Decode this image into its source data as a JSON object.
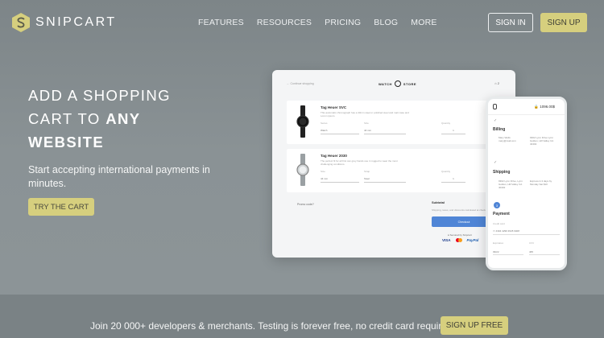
{
  "header": {
    "logo_text": "SNIPCART",
    "nav": [
      "FEATURES",
      "RESOURCES",
      "PRICING",
      "BLOG",
      "MORE"
    ],
    "sign_in": "SIGN IN",
    "sign_up": "SIGN UP"
  },
  "hero": {
    "title_part1": "ADD A SHOPPING CART TO ",
    "title_bold1": "ANY",
    "title_bold2": "WEBSITE",
    "subtitle": "Start accepting international payments in minutes.",
    "cta": "TRY THE CART"
  },
  "desktop_mockup": {
    "back_link": "← Continue shopping",
    "store_name": "WATCH STORE",
    "cart_count": "2",
    "items": [
      {
        "title": "Tag Heuer SVC",
        "desc": "This automatic chronograph has a 43mm steel or polished steel and matt case and Lorum ipsum.",
        "label_a": "Series",
        "label_b": "Size",
        "label_c": "Quantity",
        "sel_a": "Watch",
        "sel_b": "44 mm",
        "qty": "1",
        "price": "1 32"
      },
      {
        "title": "Tag Heuer 2030",
        "desc": "The perfect fit for all first can grey hands use in rugged to wear the most challenging conditions.",
        "label_a": "Size",
        "label_b": "Strap",
        "label_c": "Quantity",
        "sel_a": "44 mm",
        "sel_b": "Steel",
        "qty": "1",
        "price": ""
      }
    ],
    "promo": "Promo code?",
    "subtotal": "Subtotal",
    "shipping_note": "Shipping, taxes, and discounts calculated at checkout",
    "checkout": "Checkout",
    "secured": "Secured by Snipcart",
    "payments": [
      "VISA",
      "PayPal"
    ]
  },
  "phone_mockup": {
    "total": "1096.00$",
    "billing": "Billing",
    "billing_name": "Mary Wells mary@mail.com",
    "billing_addr": "9302 Lynn Drive Lynn Golden, Hill Valley CA 40402",
    "shipping": "Shipping",
    "shipping_a": "9302 Lynn Drive, Lynn Golden, Hill Valley CA 40402",
    "shipping_b": "Express 2-3 days by Monday Sat $10",
    "step": "3",
    "payment": "Payment",
    "card_label": "Credit card",
    "card_number": "4304 4299 3945 9408",
    "exp_label": "Expiration",
    "exp_value": "09/22",
    "cvv_label": "CVV",
    "cvv_value": "465"
  },
  "band": {
    "text": "Join 20 000+ developers & merchants. Testing is forever free, no credit card required.",
    "cta": "SIGN UP FREE"
  },
  "colors": {
    "accent": "#d6cf7e",
    "background": "#8a9295",
    "checkout_blue": "#4f85d6"
  }
}
